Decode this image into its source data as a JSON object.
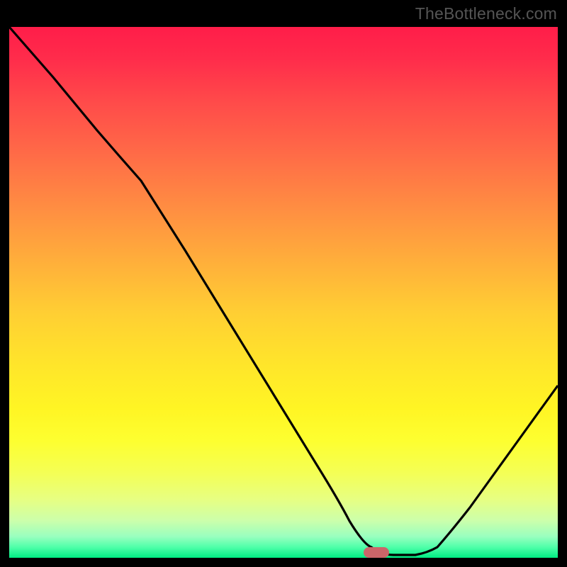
{
  "watermark": "TheBottleneck.com",
  "chart_data": {
    "type": "line",
    "title": "",
    "xlabel": "",
    "ylabel": "",
    "xlim": [
      0,
      100
    ],
    "ylim": [
      0,
      100
    ],
    "series": [
      {
        "name": "bottleneck-curve",
        "x": [
          0,
          8,
          16,
          24,
          32,
          40,
          48,
          56,
          62,
          66,
          70,
          74,
          78,
          84,
          92,
          100
        ],
        "y": [
          100,
          90.5,
          80.5,
          71,
          58,
          44.5,
          31,
          17.5,
          7,
          2,
          0.5,
          0.5,
          2,
          9.5,
          21,
          32.5
        ]
      }
    ],
    "marker": {
      "x": 67,
      "y": 0,
      "label": "optimal-point"
    }
  },
  "colors": {
    "frame": "#000000",
    "curve": "#000000",
    "marker": "#cb6569",
    "gradient_top": "#ff1d49",
    "gradient_mid": "#ffe62a",
    "gradient_bottom": "#00ed83"
  }
}
